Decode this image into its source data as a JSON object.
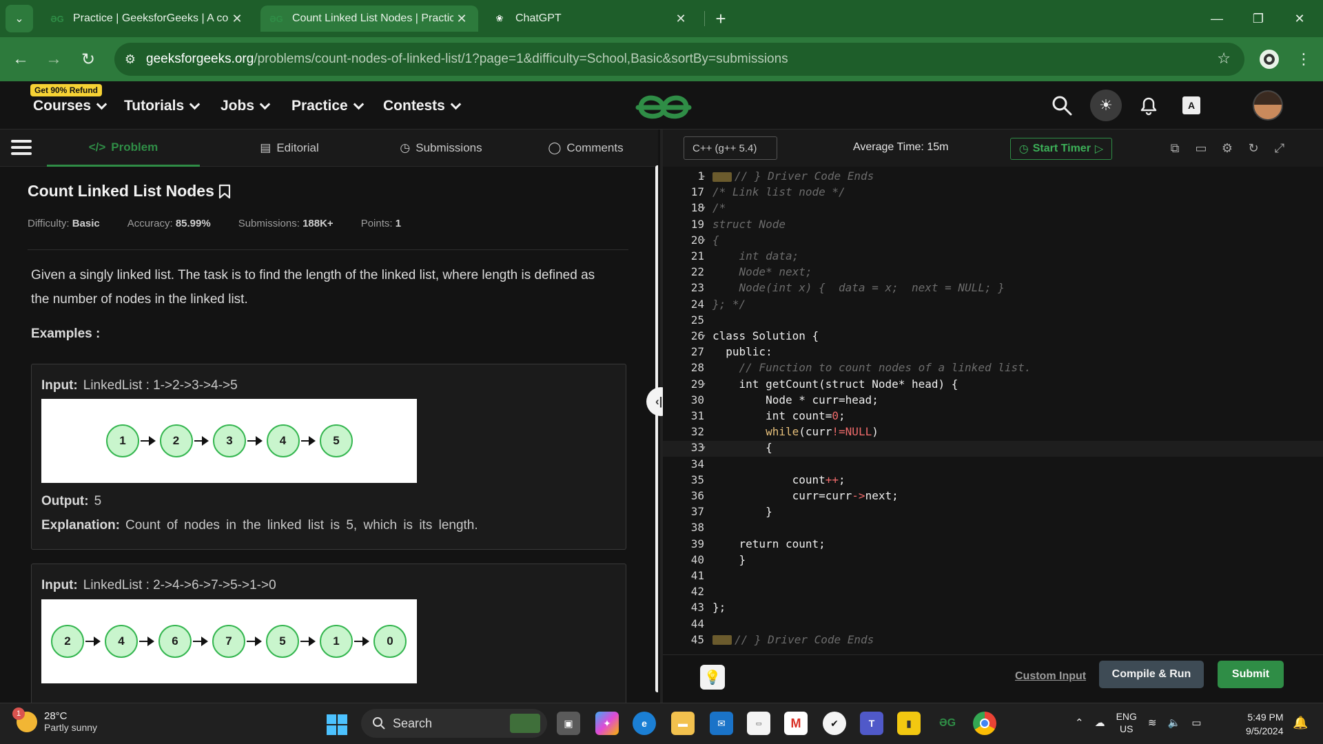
{
  "browser": {
    "tabs": [
      {
        "title": "Practice | GeeksforGeeks | A comp",
        "favicon": "gfg-icon",
        "active": false
      },
      {
        "title": "Count Linked List Nodes | Practice",
        "favicon": "gfg-icon",
        "active": true
      },
      {
        "title": "ChatGPT",
        "favicon": "chatgpt-icon",
        "active": false
      }
    ],
    "new_tab": "+",
    "url_domain": "geeksforgeeks.org",
    "url_path": "/problems/count-nodes-of-linked-list/1?page=1&difficulty=School,Basic&sortBy=submissions"
  },
  "header": {
    "refund_badge": "Get 90% Refund",
    "menus": [
      "Courses",
      "Tutorials",
      "Jobs",
      "Practice",
      "Contests"
    ],
    "logo_text": "ƏG"
  },
  "problem_tabs": [
    "Problem",
    "Editorial",
    "Submissions",
    "Comments"
  ],
  "problem": {
    "title": "Count Linked List Nodes",
    "difficulty_label": "Difficulty:",
    "difficulty": "Basic",
    "accuracy_label": "Accuracy:",
    "accuracy": "85.99%",
    "submissions_label": "Submissions:",
    "submissions": "188K+",
    "points_label": "Points:",
    "points": "1",
    "description": "Given a singly linked list. The task is to find the length of the linked list, where length is defined as the number of nodes in the linked list.",
    "examples_heading": "Examples :",
    "examples": [
      {
        "input_label": "Input:",
        "input": "LinkedList : 1->2->3->4->5",
        "nodes": [
          "1",
          "2",
          "3",
          "4",
          "5"
        ],
        "output_label": "Output:",
        "output": "5",
        "explanation_label": "Explanation:",
        "explanation": "Count of nodes in the linked list is 5, which is its length."
      },
      {
        "input_label": "Input:",
        "input": "LinkedList : 2->4->6->7->5->1->0",
        "nodes": [
          "2",
          "4",
          "6",
          "7",
          "5",
          "1",
          "0"
        ]
      }
    ]
  },
  "editor": {
    "language": "C++ (g++ 5.4)",
    "average_time": "Average Time: 15m",
    "start_timer": "Start Timer",
    "lines": [
      {
        "n": "1",
        "fold": "▸",
        "html": "<span class='collapsed-mark'></span><span class='cm'>// } Driver Code Ends</span>"
      },
      {
        "n": "17",
        "fold": "",
        "html": "<span class='cm'>/* Link list node */</span>"
      },
      {
        "n": "18",
        "fold": "▾",
        "html": "<span class='cm'>/*</span>"
      },
      {
        "n": "19",
        "fold": "",
        "html": "<span class='cm'>struct Node</span>"
      },
      {
        "n": "20",
        "fold": "▾",
        "html": "<span class='cm'>{</span>"
      },
      {
        "n": "21",
        "fold": "",
        "html": "<span class='cm'>    int data;</span>"
      },
      {
        "n": "22",
        "fold": "",
        "html": "<span class='cm'>    Node* next;</span>"
      },
      {
        "n": "23",
        "fold": "",
        "html": "<span class='cm'>    Node(int x) {  data = x;  next = NULL; }</span>"
      },
      {
        "n": "24",
        "fold": "",
        "html": "<span class='cm'>}; */</span>"
      },
      {
        "n": "25",
        "fold": "",
        "html": ""
      },
      {
        "n": "26",
        "fold": "▾",
        "html": "class Solution {"
      },
      {
        "n": "27",
        "fold": "",
        "html": "  public:"
      },
      {
        "n": "28",
        "fold": "",
        "html": "    <span class='cm'>// Function to count nodes of a linked list.</span>"
      },
      {
        "n": "29",
        "fold": "▾",
        "html": "    int getCount(struct Node* head) {"
      },
      {
        "n": "30",
        "fold": "",
        "html": "        Node * curr=head;"
      },
      {
        "n": "31",
        "fold": "",
        "html": "        int count=<span class='num'>0</span>;"
      },
      {
        "n": "32",
        "fold": "",
        "html": "        <span class='wh'>while</span>(curr<span class='op'>!=</span><span class='nul'>NULL</span>)"
      },
      {
        "n": "33",
        "fold": "▾",
        "html": "        {"
      },
      {
        "n": "34",
        "fold": "",
        "html": ""
      },
      {
        "n": "35",
        "fold": "",
        "html": "            count<span class='op'>++</span>;"
      },
      {
        "n": "36",
        "fold": "",
        "html": "            curr=curr<span class='op'>-></span>next;"
      },
      {
        "n": "37",
        "fold": "",
        "html": "        }"
      },
      {
        "n": "38",
        "fold": "",
        "html": ""
      },
      {
        "n": "39",
        "fold": "",
        "html": "    return count;"
      },
      {
        "n": "40",
        "fold": "",
        "html": "    }"
      },
      {
        "n": "41",
        "fold": "",
        "html": ""
      },
      {
        "n": "42",
        "fold": "",
        "html": ""
      },
      {
        "n": "43",
        "fold": "",
        "html": "};"
      },
      {
        "n": "44",
        "fold": "",
        "html": ""
      },
      {
        "n": "45",
        "fold": "",
        "html": "<span class='collapsed-mark'></span><span class='cm'>// } Driver Code Ends</span>"
      }
    ],
    "current_line_index": 17,
    "custom_input": "Custom Input",
    "compile_run": "Compile & Run",
    "submit": "Submit"
  },
  "taskbar": {
    "temperature": "28°C",
    "weather": "Partly sunny",
    "weather_badge": "1",
    "search": "Search",
    "lang1": "ENG",
    "lang2": "US",
    "time": "5:49 PM",
    "date": "9/5/2024"
  },
  "colors": {
    "chrome_green": "#2d7a3c",
    "gfg_green": "#2f8d46",
    "node_fill": "#c9f5cd"
  }
}
